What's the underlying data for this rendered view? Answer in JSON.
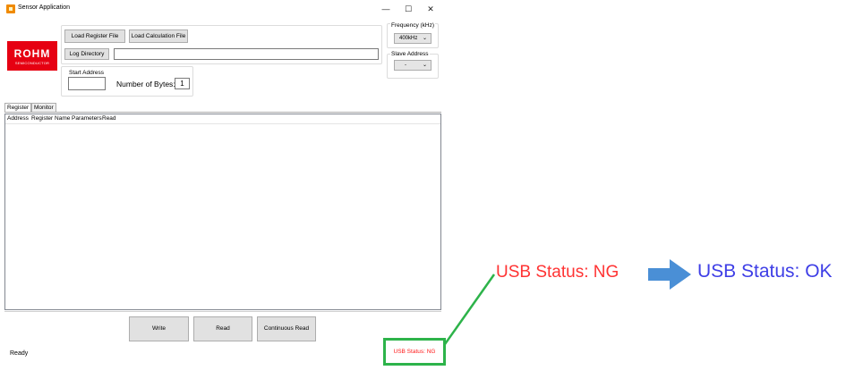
{
  "window": {
    "title": "Sensor Application",
    "minimize_glyph": "—",
    "maximize_glyph": "☐",
    "close_glyph": "✕"
  },
  "logo": {
    "main": "ROHM",
    "sub": "SEMICONDUCTOR"
  },
  "files": {
    "load_register_label": "Load Register File",
    "load_calculation_label": "Load Calculation File",
    "log_directory_label": "Log Directory",
    "log_directory_value": ""
  },
  "address": {
    "start_address_label": "Start Address",
    "start_address_value": "",
    "number_of_bytes_label": "Number of Bytes:",
    "number_of_bytes_value": "1"
  },
  "frequency": {
    "label": "Frequency (kHz)",
    "selected": "400kHz"
  },
  "slave": {
    "label": "Slave Address",
    "selected": "-"
  },
  "tabs": [
    {
      "label": "Register",
      "active": true
    },
    {
      "label": "Monitor",
      "active": false
    }
  ],
  "grid": {
    "columns": [
      "Address",
      "Register Name",
      "Parameters",
      "Read"
    ]
  },
  "actions": {
    "write_label": "Write",
    "read_label": "Read",
    "continuous_read_label": "Continuous Read"
  },
  "status": {
    "ready_text": "Ready",
    "usb_status_text": "USB Status: NG",
    "usb_status_color": "#ff1a1a"
  },
  "annotation": {
    "ng_text": "USB Status: NG",
    "ok_text": "USB Status: OK",
    "connector_color": "#2db34a",
    "arrow_color": "#4a8fd6",
    "ng_color": "#ff3333",
    "ok_color": "#3e3ee6"
  }
}
